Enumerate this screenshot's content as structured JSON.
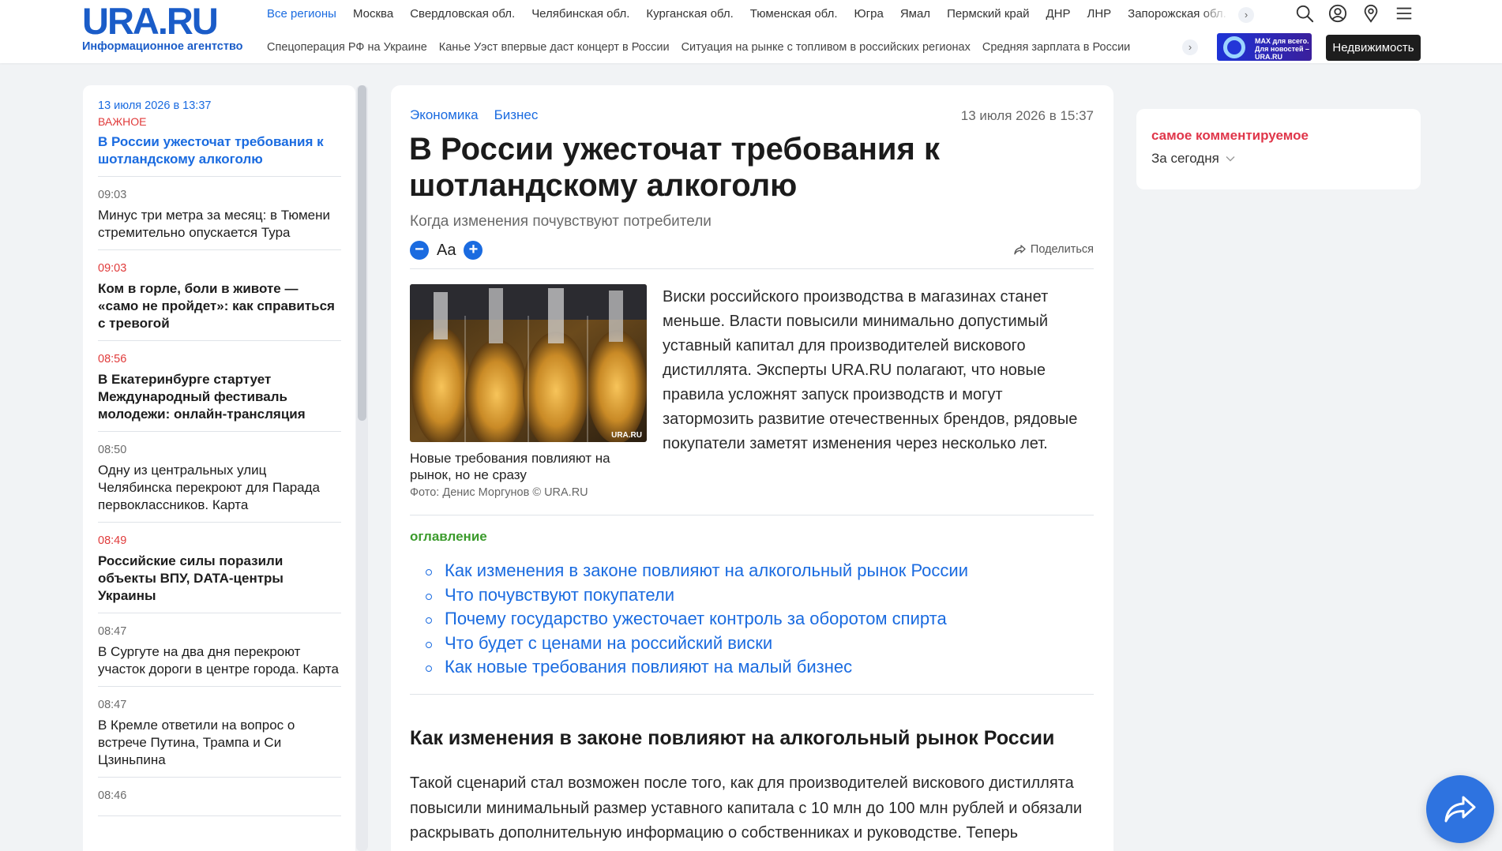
{
  "header": {
    "logo": "URA.RU",
    "logo_sub": "Информационное агентство",
    "regions": [
      "Все регионы",
      "Москва",
      "Свердловская обл.",
      "Челябинская обл.",
      "Курганская обл.",
      "Тюменская обл.",
      "Югра",
      "Ямал",
      "Пермский край",
      "ДНР",
      "ЛНР",
      "Запорожская обл."
    ],
    "topics": [
      "Спецоперация РФ на Украине",
      "Канье Уэст впервые даст концерт в России",
      "Ситуация на рынке с топливом в российских регионах",
      "Средняя зарплата в России"
    ],
    "max_banner": "MAX для всего. Для новостей – URA.RU",
    "realty_button": "Недвижимость",
    "icons": [
      "search-icon",
      "profile-icon",
      "location-icon",
      "menu-icon"
    ],
    "arrow": "›"
  },
  "feed": [
    {
      "time": "13 июля 2026 в 13:37",
      "badge": "ВАЖНОЕ",
      "title": "В России ужесточат требования к шотландскому алкоголю",
      "style": "current"
    },
    {
      "time": "09:03",
      "title": "Минус три метра за месяц: в Тюмени стремительно опускается Тура",
      "style": "normal"
    },
    {
      "time": "09:03",
      "title": "Ком в горле, боли в животе — «само не пройдет»: как справиться с тревогой",
      "style": "important"
    },
    {
      "time": "08:56",
      "title": "В Екатеринбурге стартует Международный фестиваль молодежи: онлайн-трансляция",
      "style": "important"
    },
    {
      "time": "08:50",
      "title": "Одну из центральных улиц Челябинска перекроют для Парада первоклассников. Карта",
      "style": "normal"
    },
    {
      "time": "08:49",
      "title": "Российские силы поразили объекты ВПУ, DATA-центры Украины",
      "style": "important"
    },
    {
      "time": "08:47",
      "title": "В Сургуте на два дня перекроют участок дороги в центре города. Карта",
      "style": "normal"
    },
    {
      "time": "08:47",
      "title": "В Кремле ответили на вопрос о встрече Путина, Трампа и Си Цзиньпина",
      "style": "normal"
    },
    {
      "time": "08:46",
      "title": "",
      "style": "normal"
    }
  ],
  "article": {
    "tags": [
      "Экономика",
      "Бизнес"
    ],
    "date": "13 июля 2026 в 15:37",
    "title": "В России ужесточат требования к шотландскому алкоголю",
    "subtitle": "Когда изменения почувствуют потребители",
    "font_minus": "−",
    "font_label": "Aa",
    "font_plus": "+",
    "share_label": "Поделиться",
    "photo_watermark": "URA.RU",
    "photo_caption": "Новые требования повлияют на рынок, но не сразу",
    "photo_credit": "Фото: Денис Моргунов © URA.RU",
    "lead": "Виски российского производства в магазинах станет меньше. Власти повысили минимально допустимый уставный капитал для производителей вискового дистиллята. Эксперты URA.RU полагают, что новые правила усложнят запуск производств и могут затормозить развитие отечественных брендов, рядовые покупатели заметят изменения через несколько лет.",
    "toc_label": "оглавление",
    "toc": [
      "Как изменения в законе повлияют на алкогольный рынок России",
      "Что почувствуют покупатели",
      "Почему государство ужесточает контроль за оборотом спирта",
      "Что будет с ценами на российский виски",
      "Как новые требования повлияют на малый бизнес"
    ],
    "section_title": "Как изменения в законе повлияют на алкогольный рынок России",
    "body": "Такой сценарий стал возможен после того, как для производителей вискового дистиллята повысили минимальный размер уставного капитала с 10 млн до 100 млн рублей и обязали раскрывать дополнительную информацию о собственниках и руководстве. Теперь"
  },
  "widget": {
    "title": "самое комментируемое",
    "selected": "За сегодня"
  },
  "colors": {
    "brand": "#1a5cc8",
    "link": "#1a6be0",
    "important": "#e03a3a",
    "toc_label": "#3b9b2c"
  }
}
